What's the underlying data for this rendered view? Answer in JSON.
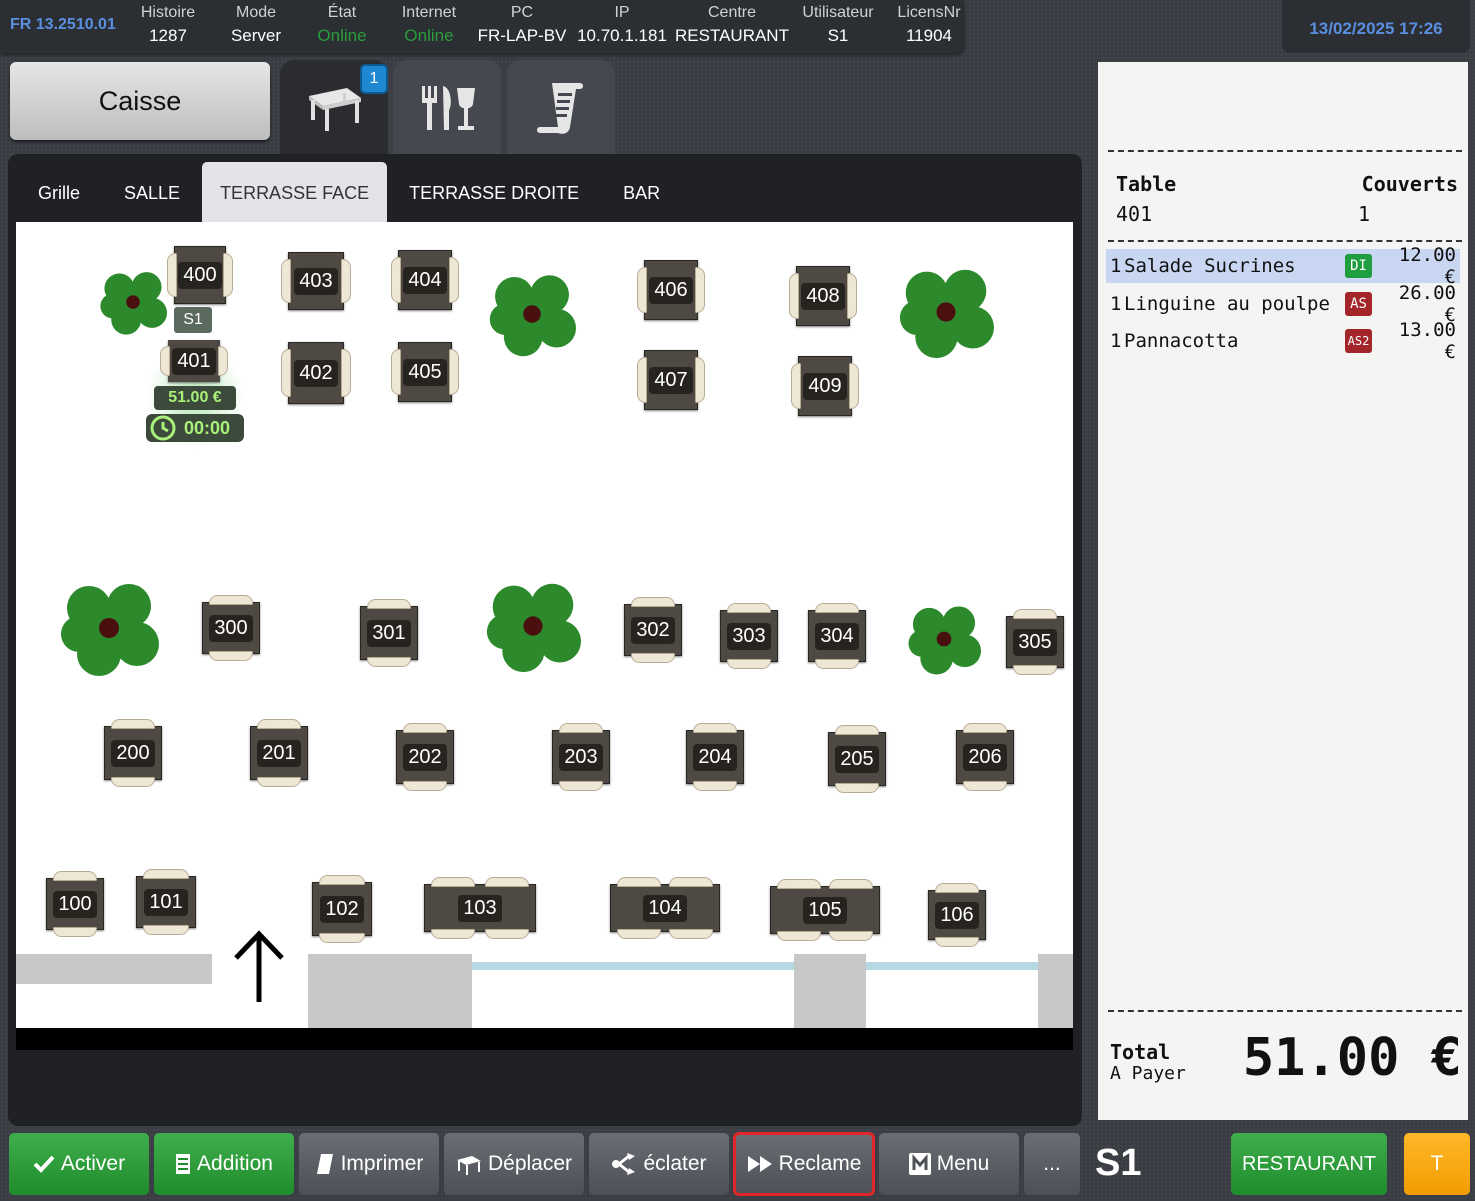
{
  "status": {
    "version": "FR 13.2510.01",
    "items": [
      {
        "label": "Histoire",
        "value": "1287"
      },
      {
        "label": "Mode",
        "value": "Server"
      },
      {
        "label": "État",
        "value": "Online"
      },
      {
        "label": "Internet",
        "value": "Online"
      },
      {
        "label": "PC",
        "value": "FR-LAP-BV"
      },
      {
        "label": "IP",
        "value": "10.70.1.181"
      },
      {
        "label": "Centre",
        "value": "RESTAURANT"
      },
      {
        "label": "Utilisateur",
        "value": "S1"
      },
      {
        "label": "LicensNr",
        "value": "11904"
      }
    ],
    "datetime": "13/02/2025 17:26"
  },
  "nav": {
    "caisse": "Caisse",
    "tables_badge": "1",
    "tabs_icons": [
      "table-icon",
      "cutlery-glass-icon",
      "receipt-icon"
    ]
  },
  "rooms": {
    "tabs": [
      "Grille",
      "SALLE",
      "TERRASSE FACE",
      "TERRASSE DROITE",
      "BAR"
    ],
    "active": "TERRASSE FACE"
  },
  "floor": {
    "tables": [
      {
        "num": "400"
      },
      {
        "num": "401"
      },
      {
        "num": "402"
      },
      {
        "num": "403"
      },
      {
        "num": "404"
      },
      {
        "num": "405"
      },
      {
        "num": "406"
      },
      {
        "num": "407"
      },
      {
        "num": "408"
      },
      {
        "num": "409"
      },
      {
        "num": "300"
      },
      {
        "num": "301"
      },
      {
        "num": "302"
      },
      {
        "num": "303"
      },
      {
        "num": "304"
      },
      {
        "num": "305"
      },
      {
        "num": "200"
      },
      {
        "num": "201"
      },
      {
        "num": "202"
      },
      {
        "num": "203"
      },
      {
        "num": "204"
      },
      {
        "num": "205"
      },
      {
        "num": "206"
      },
      {
        "num": "100"
      },
      {
        "num": "101"
      },
      {
        "num": "102"
      },
      {
        "num": "103"
      },
      {
        "num": "104"
      },
      {
        "num": "105"
      },
      {
        "num": "106"
      }
    ],
    "occupied": {
      "server": "S1",
      "amount": "51.00 €",
      "timer": "00:00"
    }
  },
  "receipt": {
    "table_label": "Table",
    "covers_label": "Couverts",
    "table_value": "401",
    "covers_value": "1",
    "lines": [
      {
        "qty": "1",
        "name": "Salade Sucrines",
        "tag": "DI",
        "tag_color": "#1e9e3e",
        "price": "12.00 €",
        "selected": true
      },
      {
        "qty": "1",
        "name": "Linguine au poulpe",
        "tag": "AS",
        "tag_color": "#a3262a",
        "price": "26.00 €",
        "selected": false
      },
      {
        "qty": "1",
        "name": "Pannacotta",
        "tag": "AS2",
        "tag_color": "#a3262a",
        "price": "13.00 €",
        "selected": false
      }
    ],
    "total_label": "Total",
    "topay_label": "A Payer",
    "total_value": "51.00 €"
  },
  "buttons": {
    "activer": "Activer",
    "addition": "Addition",
    "imprimer": "Imprimer",
    "deplacer": "Déplacer",
    "eclater": "éclater",
    "reclame": "Reclame",
    "menu": "Menu",
    "more": "...",
    "user": "S1",
    "restaurant": "RESTAURANT",
    "t": "T"
  }
}
